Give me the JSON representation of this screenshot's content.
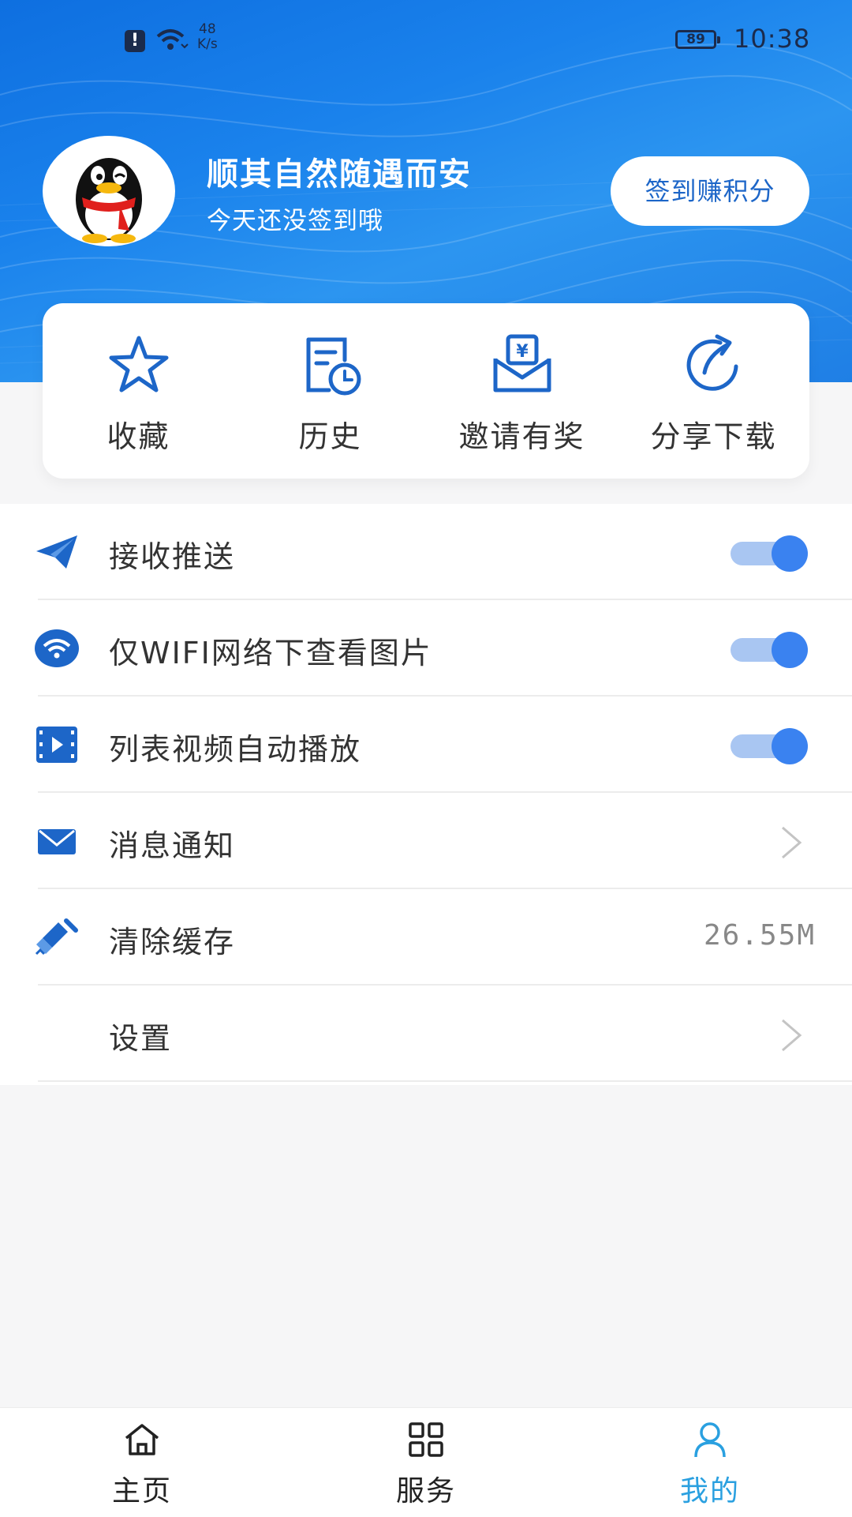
{
  "status_bar": {
    "speed_value": "48",
    "speed_unit": "K/s",
    "battery": "89",
    "time": "10:38",
    "icons": [
      "alert-icon",
      "wifi-icon",
      "battery-icon"
    ]
  },
  "profile": {
    "name": "顺其自然随遇而安",
    "subtitle": "今天还没签到哦",
    "checkin_button": "签到赚积分",
    "avatar_icon": "penguin-avatar"
  },
  "quick_actions": [
    {
      "label": "收藏",
      "icon": "star-icon"
    },
    {
      "label": "历史",
      "icon": "history-icon"
    },
    {
      "label": "邀请有奖",
      "icon": "invite-reward-icon"
    },
    {
      "label": "分享下载",
      "icon": "share-icon"
    }
  ],
  "settings": [
    {
      "label": "接收推送",
      "icon": "paper-plane-icon",
      "control": "toggle",
      "on": true
    },
    {
      "label": "仅WIFI网络下查看图片",
      "icon": "wifi-icon",
      "control": "toggle",
      "on": true
    },
    {
      "label": "列表视频自动播放",
      "icon": "video-icon",
      "control": "toggle",
      "on": true
    },
    {
      "label": "消息通知",
      "icon": "mail-icon",
      "control": "chevron"
    },
    {
      "label": "清除缓存",
      "icon": "broom-icon",
      "control": "value",
      "value": "26.55M"
    },
    {
      "label": "设置",
      "icon": "",
      "control": "chevron"
    }
  ],
  "bottom_nav": [
    {
      "label": "主页",
      "icon": "home-icon",
      "active": false
    },
    {
      "label": "服务",
      "icon": "grid-icon",
      "active": false
    },
    {
      "label": "我的",
      "icon": "user-icon",
      "active": true
    }
  ],
  "colors": {
    "header_blue": "#1a82ec",
    "accent_blue": "#3a82f0",
    "toggle_track": "#a9c6f2",
    "icon_blue": "#1d66c8",
    "active_tab": "#2aa0e0"
  }
}
